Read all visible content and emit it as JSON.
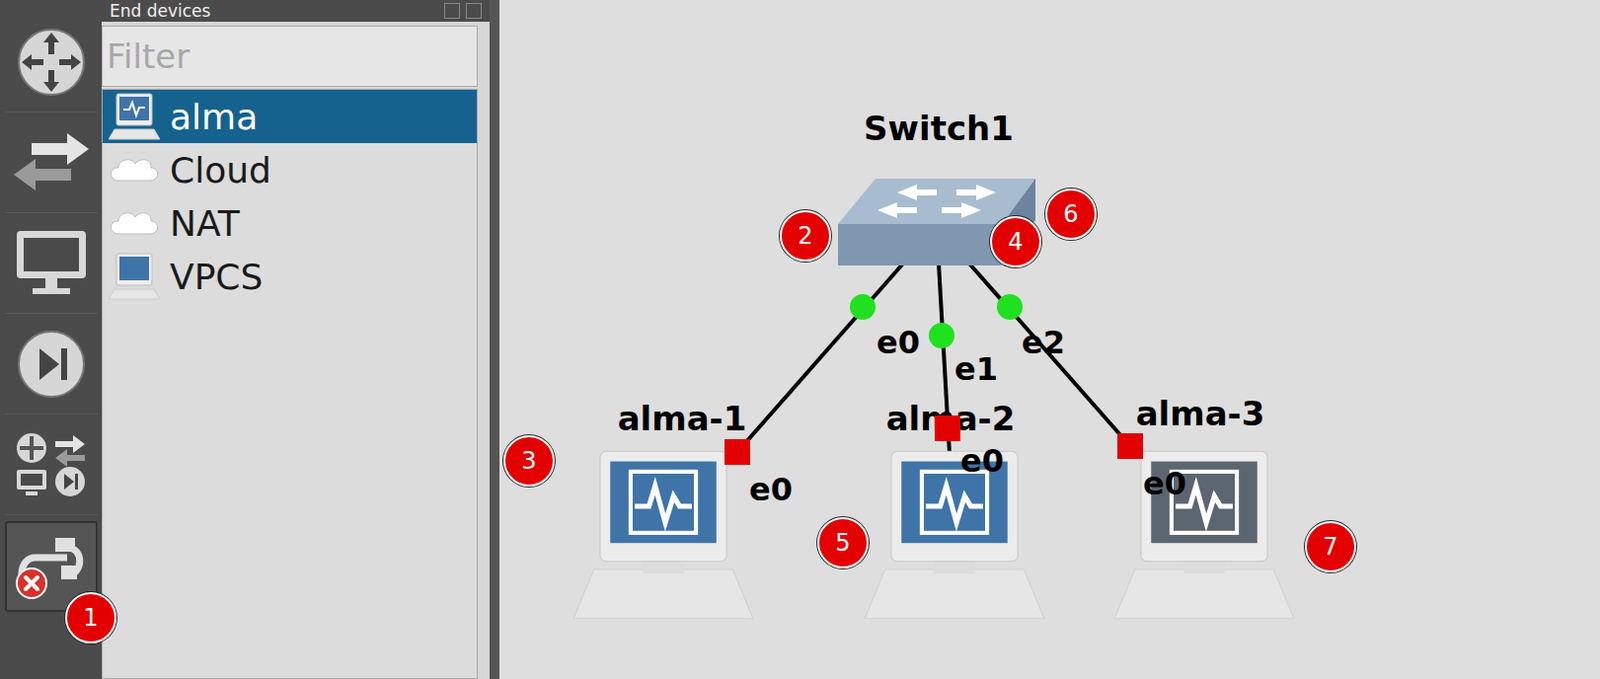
{
  "toolbar": {
    "buttons": [
      {
        "kind": "router",
        "selected": false
      },
      {
        "kind": "switch",
        "selected": false
      },
      {
        "kind": "end-device",
        "selected": false
      },
      {
        "kind": "security",
        "selected": false
      },
      {
        "kind": "all",
        "selected": false
      },
      {
        "kind": "link",
        "selected": true
      }
    ],
    "badge": "1"
  },
  "panel": {
    "title": "End devices",
    "filter": {
      "placeholder": "Filter"
    },
    "items": [
      {
        "label": "alma",
        "kind": "vm",
        "selected": true
      },
      {
        "label": "Cloud",
        "kind": "cloud",
        "selected": false
      },
      {
        "label": "NAT",
        "kind": "cloud",
        "selected": false
      },
      {
        "label": "VPCS",
        "kind": "vpcs",
        "selected": false
      }
    ]
  },
  "canvas": {
    "switch": {
      "label": "Switch1"
    },
    "hosts": [
      {
        "label": "alma-1",
        "dimmed": false
      },
      {
        "label": "alma-2",
        "dimmed": false
      },
      {
        "label": "alma-3",
        "dimmed": true
      }
    ],
    "links": [
      {
        "switch_port": "e0",
        "host_port": "e0",
        "switch_up": true,
        "host_up": false
      },
      {
        "switch_port": "e1",
        "host_port": "e0",
        "switch_up": true,
        "host_up": false
      },
      {
        "switch_port": "e2",
        "host_port": "e0",
        "switch_up": true,
        "host_up": false
      }
    ],
    "annotations": [
      "2",
      "3",
      "4",
      "5",
      "6",
      "7"
    ]
  }
}
